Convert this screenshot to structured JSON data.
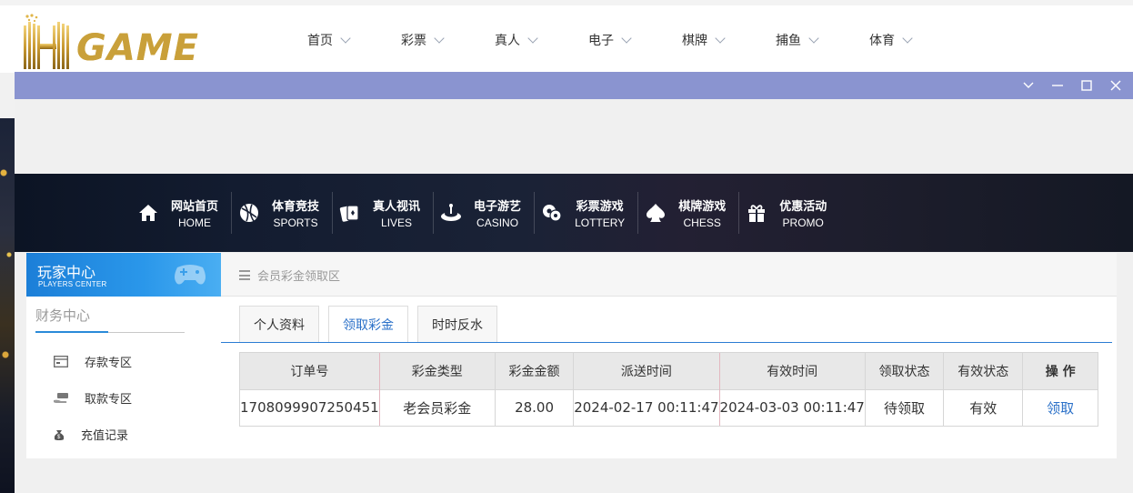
{
  "logo": {
    "text_hh": "HH",
    "text_game": "GAME"
  },
  "top_nav": [
    {
      "label": "首页"
    },
    {
      "label": "彩票"
    },
    {
      "label": "真人"
    },
    {
      "label": "电子"
    },
    {
      "label": "棋牌"
    },
    {
      "label": "捕鱼"
    },
    {
      "label": "体育"
    }
  ],
  "banner_nav": [
    {
      "cn": "网站首页",
      "en": "HOME",
      "icon": "home-icon"
    },
    {
      "cn": "体育竞技",
      "en": "SPORTS",
      "icon": "ball-icon"
    },
    {
      "cn": "真人视讯",
      "en": "LIVES",
      "icon": "cards-icon"
    },
    {
      "cn": "电子游艺",
      "en": "CASINO",
      "icon": "slot-icon"
    },
    {
      "cn": "彩票游戏",
      "en": "LOTTERY",
      "icon": "lottery-balls-icon"
    },
    {
      "cn": "棋牌游戏",
      "en": "CHESS",
      "icon": "spade-icon"
    },
    {
      "cn": "优惠活动",
      "en": "PROMO",
      "icon": "gift-icon"
    }
  ],
  "sidebar": {
    "head_cn": "玩家中心",
    "head_en": "PLAYERS CENTER",
    "section_title": "财务中心",
    "items": [
      {
        "label": "存款专区",
        "icon": "deposit-card-icon"
      },
      {
        "label": "取款专区",
        "icon": "withdraw-hand-icon"
      },
      {
        "label": "充值记录",
        "icon": "money-bag-icon"
      }
    ]
  },
  "main": {
    "breadcrumb": "会员彩金领取区",
    "tabs": [
      {
        "label": "个人资料"
      },
      {
        "label": "领取彩金"
      },
      {
        "label": "时时反水"
      }
    ],
    "table": {
      "headers": [
        "订单号",
        "彩金类型",
        "彩金金额",
        "派送时间",
        "有效时间",
        "领取状态",
        "有效状态",
        "操 作"
      ],
      "rows": [
        [
          "1708099907250451",
          "老会员彩金",
          "28.00",
          "2024-02-17 00:11:47",
          "2024-03-03 00:11:47",
          "待领取",
          "有效",
          "领取"
        ]
      ]
    }
  }
}
